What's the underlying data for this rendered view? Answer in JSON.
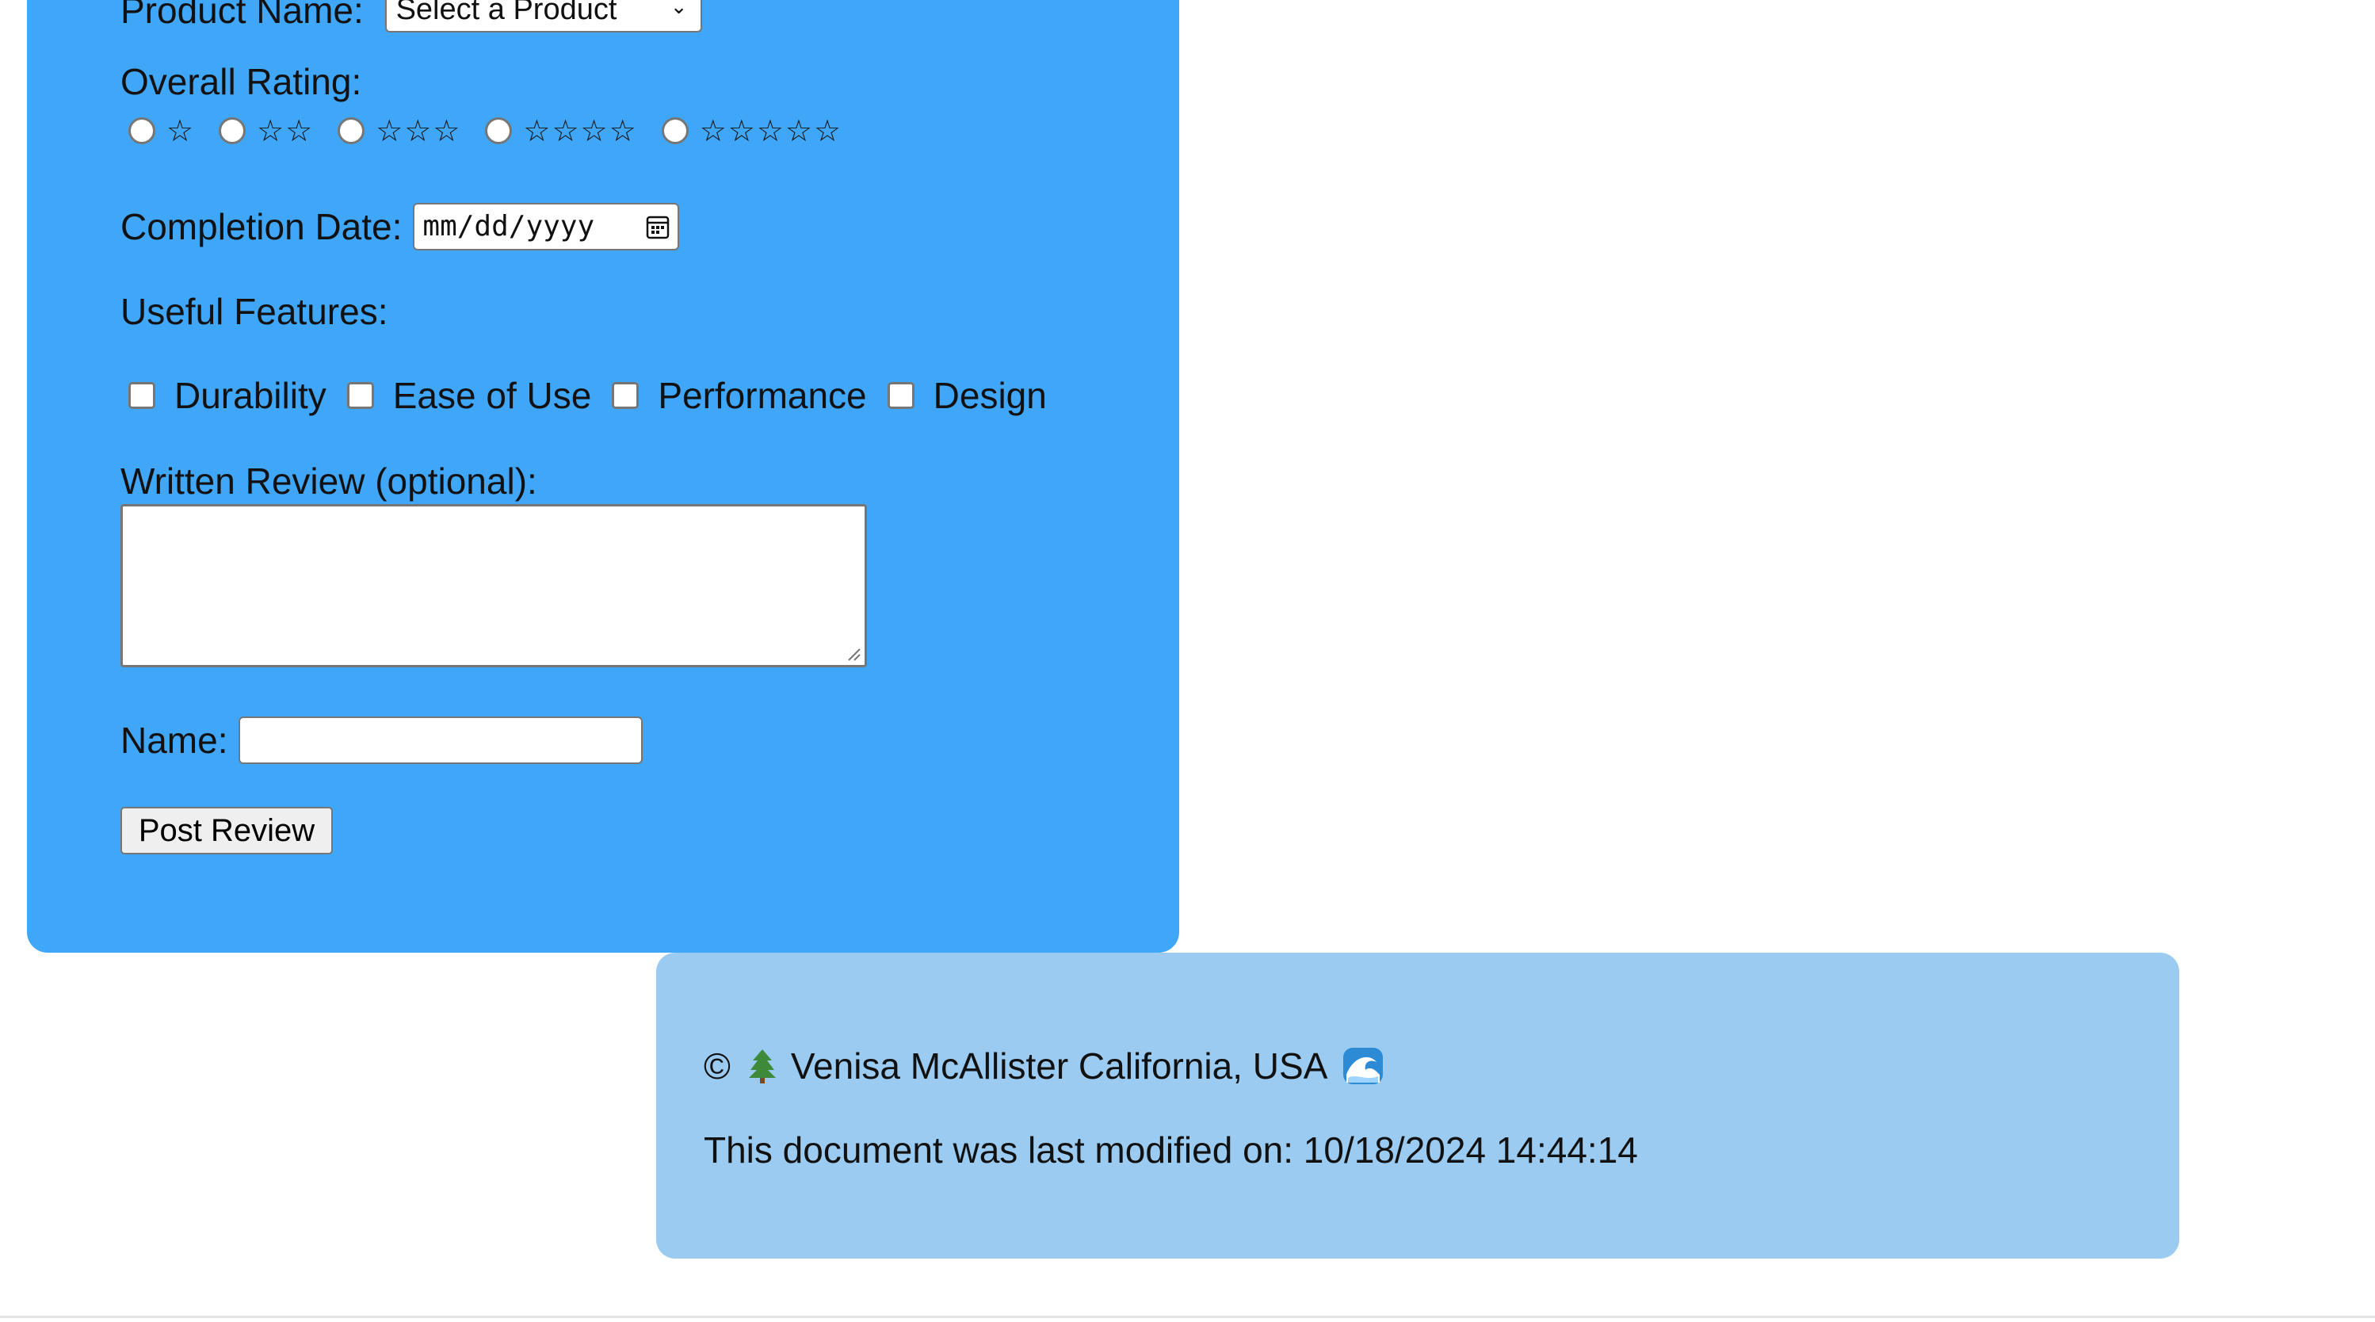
{
  "form": {
    "product_label": "Product Name:",
    "product_select_value": "Select a Product",
    "rating_label": "Overall Rating:",
    "rating_options": [
      "☆",
      "☆☆",
      "☆☆☆",
      "☆☆☆☆",
      "☆☆☆☆☆"
    ],
    "date_label": "Completion Date:",
    "date_placeholder": "mm/dd/yyyy",
    "features_label": "Useful Features:",
    "features": [
      "Durability",
      "Ease of Use",
      "Performance",
      "Design"
    ],
    "review_label": "Written Review (optional):",
    "review_value": "",
    "name_label": "Name:",
    "name_value": "",
    "submit_label": "Post Review"
  },
  "footer": {
    "copyright_symbol": "©",
    "author_location": "Venisa McAllister California, USA",
    "last_modified": "This document was last modified on: 10/18/2024 14:44:14",
    "icons": [
      "tree-icon",
      "water-wave-icon"
    ]
  },
  "colors": {
    "form_bg": "#40a6f8",
    "footer_bg": "#9ccbf1"
  }
}
